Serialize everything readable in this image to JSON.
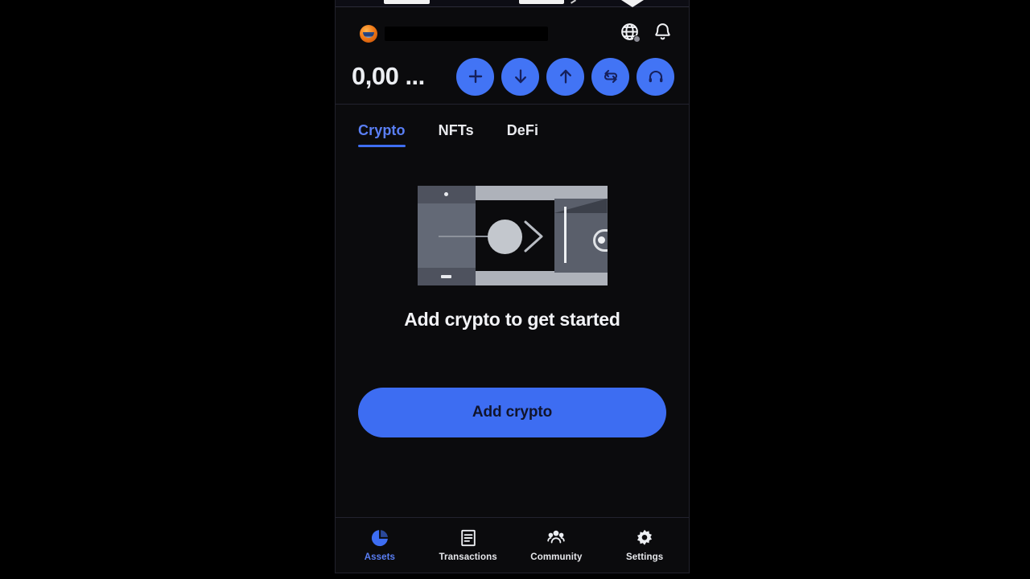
{
  "theme": {
    "accent_blue": "#3d6df2",
    "accent_blue_light": "#5a7ff5",
    "action_button_blue": "#4274f5",
    "background": "#0b0b0d",
    "text_primary": "#f2f3f6",
    "button_text_dark": "#11142b",
    "border": "#23232e"
  },
  "header": {
    "avatar_icon": "user-avatar",
    "account_name": "",
    "account_name_redacted": true,
    "balance": "0,00 ...",
    "icons": [
      {
        "name": "globe-icon",
        "label": "Network",
        "badge": true
      },
      {
        "name": "bell-icon",
        "label": "Notifications",
        "badge": false
      }
    ],
    "actions": [
      {
        "name": "buy-button",
        "icon": "plus-icon",
        "label": "Buy"
      },
      {
        "name": "receive-button",
        "icon": "arrow-down-icon",
        "label": "Receive"
      },
      {
        "name": "send-button",
        "icon": "arrow-up-icon",
        "label": "Send"
      },
      {
        "name": "swap-button",
        "icon": "swap-icon",
        "label": "Swap"
      },
      {
        "name": "support-button",
        "icon": "headset-icon",
        "label": "Support"
      }
    ]
  },
  "tabs": [
    {
      "label": "Crypto",
      "active": true
    },
    {
      "label": "NFTs",
      "active": false
    },
    {
      "label": "DeFi",
      "active": false
    }
  ],
  "empty_state": {
    "illustration": "coin-into-wallet-illustration",
    "title": "Add crypto to get started",
    "cta_label": "Add crypto"
  },
  "bottom_nav": [
    {
      "label": "Assets",
      "icon": "pie-chart-icon",
      "active": true
    },
    {
      "label": "Transactions",
      "icon": "document-icon",
      "active": false
    },
    {
      "label": "Community",
      "icon": "people-icon",
      "active": false
    },
    {
      "label": "Settings",
      "icon": "gear-icon",
      "active": false
    }
  ]
}
